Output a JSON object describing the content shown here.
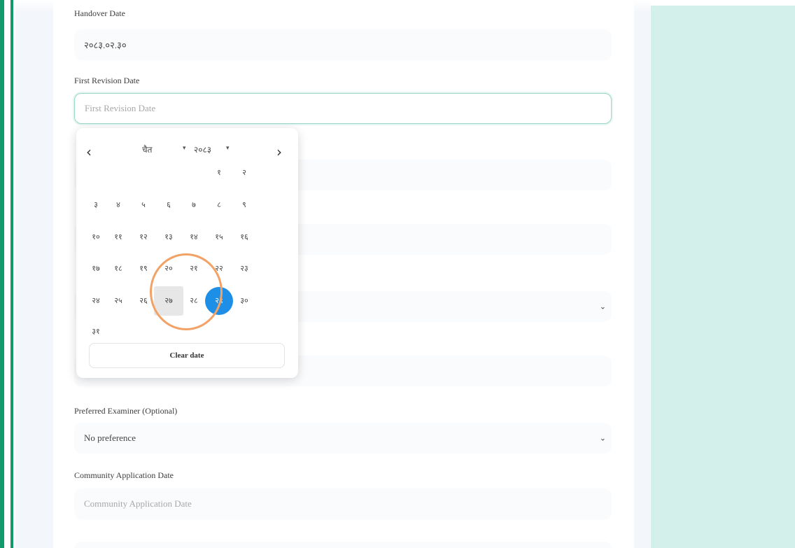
{
  "form": {
    "handover": {
      "label": "Handover Date",
      "value": "२०८३.०२.३०"
    },
    "first_revision": {
      "label": "First Revision Date",
      "placeholder": "First Revision Date"
    },
    "preferred_examiner": {
      "label": "Preferred Examiner (Optional)",
      "value": "No preference"
    },
    "community_application": {
      "label": "Community Application Date",
      "placeholder": "Community Application Date"
    }
  },
  "calendar": {
    "month": "चैत",
    "year": "२०८३",
    "prev_icon": "chevron-left-icon",
    "next_icon": "chevron-right-icon",
    "weeks": [
      [
        "",
        "",
        "",
        "",
        "",
        "१",
        "२"
      ],
      [
        "३",
        "४",
        "५",
        "६",
        "७",
        "८",
        "९"
      ],
      [
        "१०",
        "११",
        "१२",
        "१३",
        "१४",
        "१५",
        "१६"
      ],
      [
        "१७",
        "१८",
        "१९",
        "२०",
        "२१",
        "२२",
        "२३"
      ],
      [
        "२४",
        "२५",
        "२६",
        "२७",
        "२८",
        "२९",
        "३०"
      ],
      [
        "३१",
        "",
        "",
        "",
        "",
        "",
        ""
      ]
    ],
    "hovered_day": "२७",
    "selected_day": "२९",
    "clear_label": "Clear date"
  },
  "colors": {
    "accent_green": "#129a6a",
    "selected_blue": "#1e8fe6",
    "highlight_ring": "#f2a266",
    "side_panel": "#d3f1ea"
  }
}
